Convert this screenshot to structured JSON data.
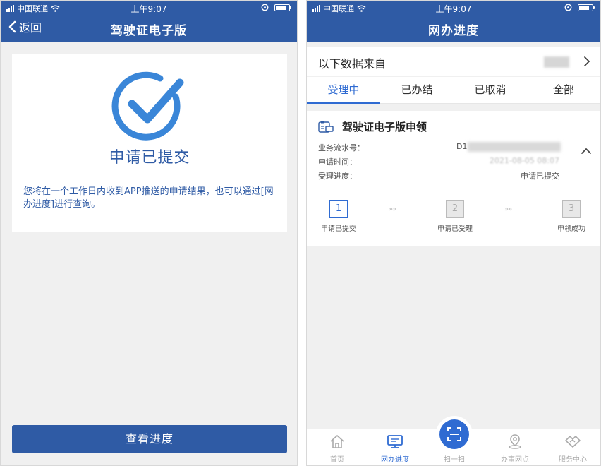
{
  "status_bar": {
    "carrier": "中国联通",
    "time": "上午9:07"
  },
  "left_screen": {
    "back_label": "返回",
    "title": "驾驶证电子版",
    "result_title": "申请已提交",
    "result_desc": "您将在一个工作日内收到APP推送的申请结果，也可以通过[网办进度]进行查询。",
    "button_label": "查看进度"
  },
  "right_screen": {
    "title": "网办进度",
    "source_label": "以下数据来自",
    "tabs": [
      "受理中",
      "已办结",
      "已取消",
      "全部"
    ],
    "active_tab": 0,
    "card": {
      "title": "驾驶证电子版申领",
      "serial_label": "业务流水号：",
      "serial_value": "D1",
      "time_label": "申请时间：",
      "time_value": "2021-08-05 08:07",
      "progress_label": "受理进度：",
      "progress_value": "申请已提交"
    },
    "steps": [
      {
        "num": "1",
        "label": "申请已提交",
        "active": true
      },
      {
        "num": "2",
        "label": "申请已受理",
        "active": false
      },
      {
        "num": "3",
        "label": "申领成功",
        "active": false
      }
    ],
    "step_arrow": "»»",
    "tabbar": {
      "home": "首页",
      "progress": "网办进度",
      "scan": "扫一扫",
      "outlets": "办事网点",
      "service": "服务中心"
    }
  },
  "colors": {
    "primary": "#2f5ba5",
    "accent": "#2f6bd2",
    "check": "#3a86d8"
  }
}
